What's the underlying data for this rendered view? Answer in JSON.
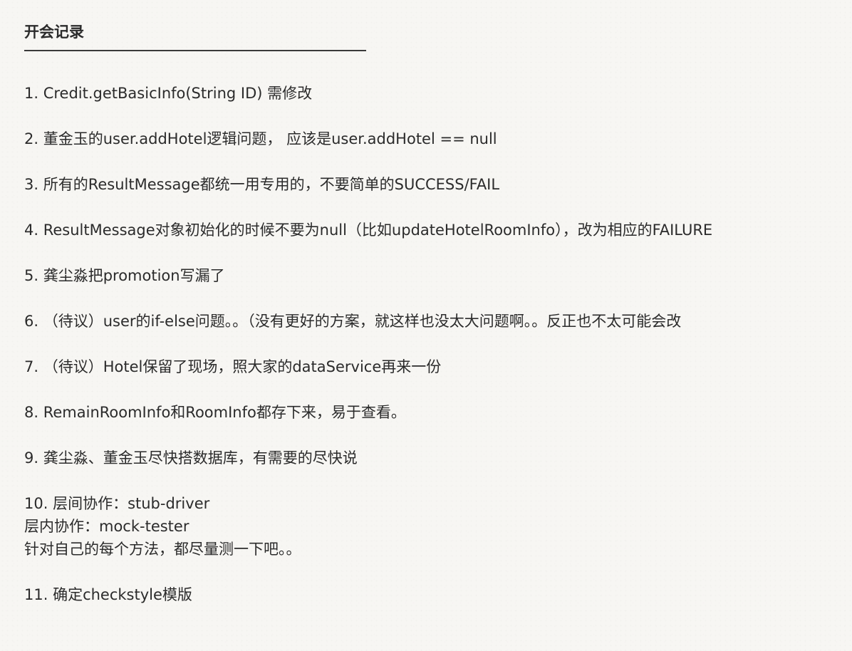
{
  "title": "开会记录",
  "items": [
    {
      "lines": [
        "1. Credit.getBasicInfo(String ID) 需修改"
      ]
    },
    {
      "lines": [
        "2. 董金玉的user.addHotel逻辑问题，  应该是user.addHotel == null"
      ]
    },
    {
      "lines": [
        "3. 所有的ResultMessage都统一用专用的，不要简单的SUCCESS/FAIL"
      ]
    },
    {
      "lines": [
        "4. ResultMessage对象初始化的时候不要为null（比如updateHotelRoomInfo），改为相应的FAILURE"
      ]
    },
    {
      "lines": [
        "5. 龚尘淼把promotion写漏了"
      ]
    },
    {
      "lines": [
        "6. （待议）user的if-else问题。。（没有更好的方案，就这样也没太大问题啊。。反正也不太可能会改"
      ]
    },
    {
      "lines": [
        "7. （待议）Hotel保留了现场，照大家的dataService再来一份"
      ]
    },
    {
      "lines": [
        "8. RemainRoomInfo和RoomInfo都存下来，易于查看。"
      ]
    },
    {
      "lines": [
        "9. 龚尘淼、董金玉尽快搭数据库，有需要的尽快说"
      ]
    },
    {
      "lines": [
        "10. 层间协作：stub-driver",
        "层内协作：mock-tester",
        "针对自己的每个方法，都尽量测一下吧。。"
      ]
    },
    {
      "lines": [
        "11. 确定checkstyle模版"
      ]
    }
  ]
}
